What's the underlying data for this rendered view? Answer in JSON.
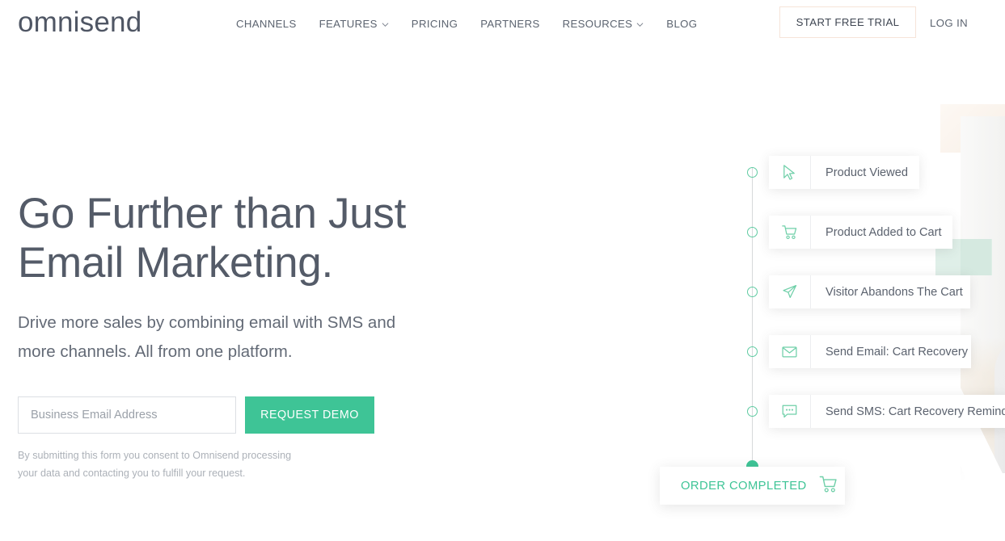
{
  "brand": {
    "logo_text": "omnisend",
    "accent_green": "#3ec496",
    "text_dark": "#545b68"
  },
  "header": {
    "nav": [
      {
        "label": "CHANNELS",
        "has_dropdown": false,
        "icon": ""
      },
      {
        "label": "FEATURES",
        "has_dropdown": true,
        "icon": "chevron-down-icon"
      },
      {
        "label": "PRICING",
        "has_dropdown": false,
        "icon": ""
      },
      {
        "label": "PARTNERS",
        "has_dropdown": false,
        "icon": ""
      },
      {
        "label": "RESOURCES",
        "has_dropdown": true,
        "icon": "chevron-down-icon"
      },
      {
        "label": "BLOG",
        "has_dropdown": false,
        "icon": ""
      }
    ],
    "trial_button": "START FREE TRIAL",
    "login_link": "LOG IN"
  },
  "hero": {
    "headline_line1": "Go Further than Just",
    "headline_line2": "Email Marketing.",
    "subhead_line1": "Drive more sales by combining email with SMS and",
    "subhead_line2": "more channels. All from one platform.",
    "email_placeholder": "Business Email Address",
    "email_value": "",
    "demo_button": "REQUEST DEMO",
    "fineprint_line1": "By submitting this form you consent to Omnisend processing",
    "fineprint_line2": "your data and contacting you to fulfill your request."
  },
  "workflow": {
    "steps": [
      {
        "label": "Product Viewed",
        "icon": "cursor-pointer-icon"
      },
      {
        "label": "Product Added to Cart",
        "icon": "shopping-cart-icon"
      },
      {
        "label": "Visitor Abandons The Cart",
        "icon": "paper-plane-icon"
      },
      {
        "label": "Send Email: Cart Recovery",
        "icon": "envelope-icon"
      },
      {
        "label": "Send SMS: Cart Recovery Reminder",
        "icon": "chat-bubble-dots-icon"
      }
    ],
    "completion": {
      "label": "ORDER COMPLETED",
      "icon": "shopping-cart-icon"
    }
  }
}
